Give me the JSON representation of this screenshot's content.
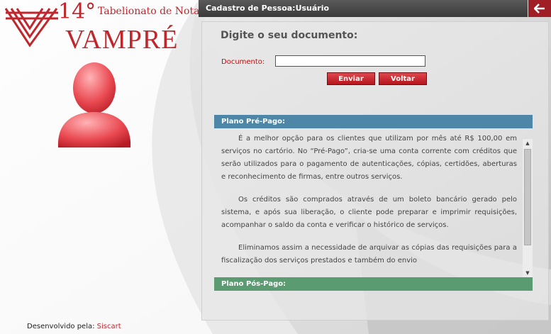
{
  "logo": {
    "number": "14°",
    "subtitle": "Tabelionato de Notas",
    "name": "VAMPRÉ"
  },
  "header": {
    "title": "Cadastro de Pessoa:Usuário"
  },
  "form": {
    "heading": "Digite o seu documento:",
    "document_label": "Documento:",
    "document_value": "",
    "submit_label": "Enviar",
    "back_label": "Voltar"
  },
  "plans": {
    "pre": {
      "title": "Plano Pré-Pago:",
      "paragraphs": [
        "É a melhor opção para os clientes que utilizam por mês até R$ 100,00 em serviços no cartório. No “Pré-Pago”, cria-se uma conta corrente com créditos que serão utilizados para o pagamento de autenticações, cópias, certidões, aberturas e reconhecimento de firmas, entre outros serviços.",
        "Os créditos são comprados através de um boleto bancário gerado pelo sistema, e após sua liberação, o cliente pode preparar e imprimir requisições, acompanhar o saldo da conta e verificar o histórico de serviços.",
        "Eliminamos assim a necessidade de arquivar as cópias das requisições para a fiscalização dos serviços prestados e também do envio"
      ]
    },
    "pos": {
      "title": "Plano Pós-Pago:"
    }
  },
  "footer": {
    "prefix": "Desenvolvido pela:",
    "brand": "Siscart"
  },
  "colors": {
    "brand_red": "#c0272d",
    "pre_header": "#4d86a6",
    "pos_header": "#5a9b72"
  }
}
